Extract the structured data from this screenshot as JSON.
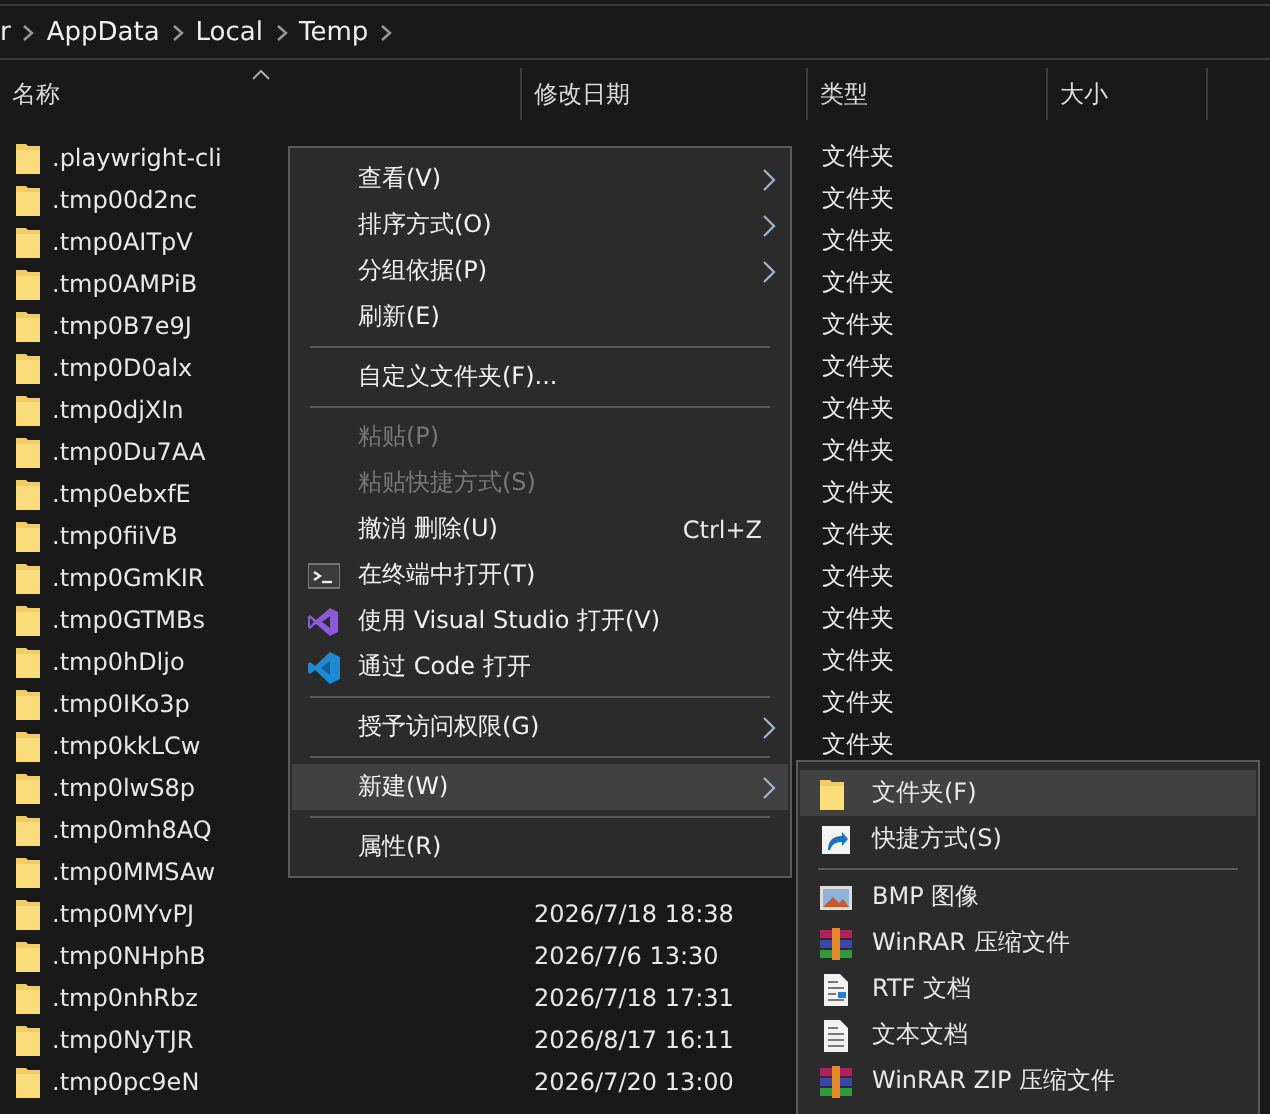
{
  "breadcrumb": [
    "r",
    "AppData",
    "Local",
    "Temp"
  ],
  "columns": [
    {
      "label": "名称",
      "sorted": true
    },
    {
      "label": "修改日期",
      "sorted": false
    },
    {
      "label": "类型",
      "sorted": false
    },
    {
      "label": "大小",
      "sorted": false
    }
  ],
  "rows": [
    {
      "name": ".playwright-cli",
      "type": "文件夹"
    },
    {
      "name": ".tmp00d2nc",
      "type": "文件夹"
    },
    {
      "name": ".tmp0AITpV",
      "type": "文件夹"
    },
    {
      "name": ".tmp0AMPiB",
      "type": "文件夹"
    },
    {
      "name": ".tmp0B7e9J",
      "type": "文件夹"
    },
    {
      "name": ".tmp0D0alx",
      "type": "文件夹"
    },
    {
      "name": ".tmp0djXIn",
      "type": "文件夹"
    },
    {
      "name": ".tmp0Du7AA",
      "type": "文件夹"
    },
    {
      "name": ".tmp0ebxfE",
      "type": "文件夹"
    },
    {
      "name": ".tmp0fiiVB",
      "type": "文件夹"
    },
    {
      "name": ".tmp0GmKIR",
      "type": "文件夹"
    },
    {
      "name": ".tmp0GTMBs",
      "type": "文件夹"
    },
    {
      "name": ".tmp0hDljo",
      "type": "文件夹"
    },
    {
      "name": ".tmp0IKo3p",
      "type": "文件夹"
    },
    {
      "name": ".tmp0kkLCw",
      "type": "文件夹"
    },
    {
      "name": ".tmp0lwS8p"
    },
    {
      "name": ".tmp0mh8AQ"
    },
    {
      "name": ".tmp0MMSAw"
    },
    {
      "name": ".tmp0MYvPJ",
      "date": "2026/7/18 18:38"
    },
    {
      "name": ".tmp0NHphB",
      "date": "2026/7/6 13:30"
    },
    {
      "name": ".tmp0nhRbz",
      "date": "2026/7/18 17:31"
    },
    {
      "name": ".tmp0NyTJR",
      "date": "2026/8/17 16:11"
    },
    {
      "name": ".tmp0pc9eN",
      "date": "2026/7/20 13:00"
    }
  ],
  "context_menu": [
    {
      "kind": "item",
      "label": "查看(V)",
      "submenu": true,
      "disabled": false,
      "selected": false
    },
    {
      "kind": "item",
      "label": "排序方式(O)",
      "submenu": true,
      "disabled": false,
      "selected": false
    },
    {
      "kind": "item",
      "label": "分组依据(P)",
      "submenu": true,
      "disabled": false,
      "selected": false
    },
    {
      "kind": "item",
      "label": "刷新(E)",
      "submenu": false,
      "disabled": false,
      "selected": false
    },
    {
      "kind": "separator"
    },
    {
      "kind": "item",
      "label": "自定义文件夹(F)...",
      "submenu": false,
      "disabled": false,
      "selected": false
    },
    {
      "kind": "separator"
    },
    {
      "kind": "item",
      "label": "粘贴(P)",
      "submenu": false,
      "disabled": true,
      "selected": false
    },
    {
      "kind": "item",
      "label": "粘贴快捷方式(S)",
      "submenu": false,
      "disabled": true,
      "selected": false
    },
    {
      "kind": "item",
      "label": "撤消 删除(U)",
      "shortcut": "Ctrl+Z",
      "submenu": false,
      "disabled": false,
      "selected": false
    },
    {
      "kind": "terminal",
      "label": "在终端中打开(T)",
      "submenu": false,
      "disabled": false,
      "selected": false
    },
    {
      "kind": "studio",
      "label": "使用 Visual Studio 打开(V)",
      "submenu": false,
      "disabled": false,
      "selected": false
    },
    {
      "kind": "editor",
      "label": "通过 Code 打开",
      "submenu": false,
      "disabled": false,
      "selected": false
    },
    {
      "kind": "separator"
    },
    {
      "kind": "item",
      "label": "授予访问权限(G)",
      "submenu": true,
      "disabled": false,
      "selected": false
    },
    {
      "kind": "separator"
    },
    {
      "kind": "item",
      "label": "新建(W)",
      "submenu": true,
      "disabled": false,
      "selected": true
    },
    {
      "kind": "separator"
    },
    {
      "kind": "item",
      "label": "属性(R)",
      "submenu": false,
      "disabled": false,
      "selected": false
    }
  ],
  "new_submenu": [
    {
      "kind": "folder",
      "label": "文件夹(F)",
      "selected": true
    },
    {
      "kind": "shortcut",
      "label": "快捷方式(S)",
      "selected": false
    },
    {
      "kind": "separator"
    },
    {
      "kind": "image",
      "label": "BMP 图像",
      "selected": false
    },
    {
      "kind": "archive",
      "label": "WinRAR 压缩文件",
      "selected": false
    },
    {
      "kind": "document",
      "label": "RTF 文档",
      "selected": false
    },
    {
      "kind": "text",
      "label": "文本文档",
      "selected": false
    },
    {
      "kind": "archive",
      "label": "WinRAR ZIP 压缩文件",
      "selected": false
    }
  ]
}
